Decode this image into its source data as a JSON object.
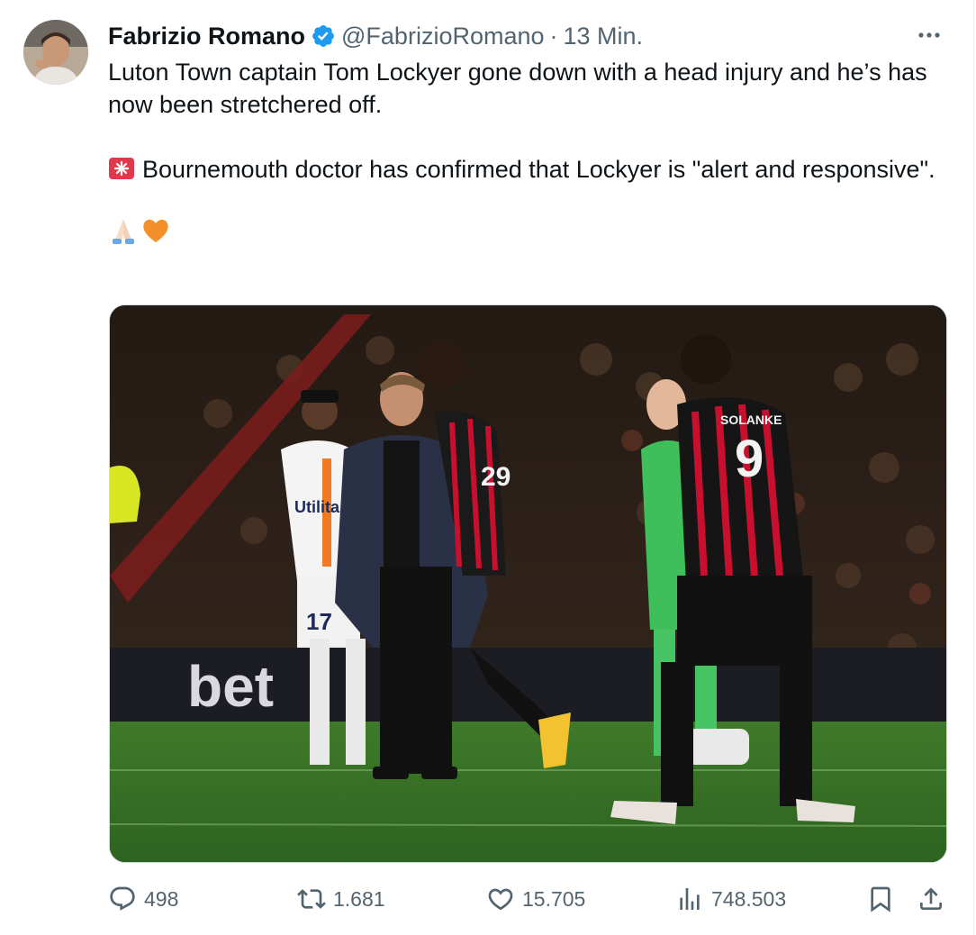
{
  "tweet": {
    "author_name": "Fabrizio Romano",
    "handle": "@FabrizioRomano",
    "separator": "·",
    "time": "13 Min.",
    "verified": true,
    "text_line1": "Luton Town captain Tom Lockyer gone down with a head injury and he’s has now been stretchered off.",
    "text_line2": "Bournemouth doctor has confirmed that Lockyer is \"alert and responsive\".",
    "emojis": [
      "praying-hands-icon",
      "orange-heart-icon"
    ],
    "photo_text": {
      "shirt_name": "SOLANKE",
      "shirt_number": "9",
      "board_text": "bet",
      "sponsor_text": "Utilita",
      "number_17": "17",
      "number_29": "29"
    }
  },
  "actions": {
    "replies": "498",
    "reposts": "1.681",
    "likes": "15.705",
    "views": "748.503"
  },
  "colors": {
    "text": "#0f1419",
    "secondary": "#536471",
    "verified_blue": "#1d9bf0",
    "border": "#cfd9de"
  }
}
